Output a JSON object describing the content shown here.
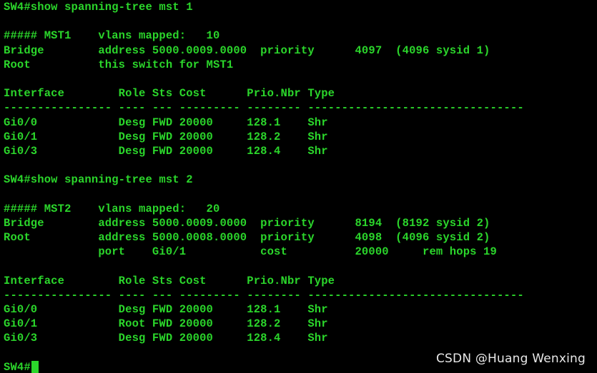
{
  "terminal": {
    "lines": [
      "SW4#show spanning-tree mst 1",
      "",
      "##### MST1    vlans mapped:   10",
      "Bridge        address 5000.0009.0000  priority      4097  (4096 sysid 1)",
      "Root          this switch for MST1",
      "",
      "Interface        Role Sts Cost      Prio.Nbr Type",
      "---------------- ---- --- --------- -------- --------------------------------",
      "Gi0/0            Desg FWD 20000     128.1    Shr",
      "Gi0/1            Desg FWD 20000     128.2    Shr",
      "Gi0/3            Desg FWD 20000     128.4    Shr",
      "",
      "SW4#show spanning-tree mst 2",
      "",
      "##### MST2    vlans mapped:   20",
      "Bridge        address 5000.0009.0000  priority      8194  (8192 sysid 2)",
      "Root          address 5000.0008.0000  priority      4098  (4096 sysid 2)",
      "              port    Gi0/1           cost          20000     rem hops 19",
      "",
      "Interface        Role Sts Cost      Prio.Nbr Type",
      "---------------- ---- --- --------- -------- --------------------------------",
      "Gi0/0            Desg FWD 20000     128.1    Shr",
      "Gi0/1            Root FWD 20000     128.2    Shr",
      "Gi0/3            Desg FWD 20000     128.4    Shr",
      ""
    ],
    "prompt": "SW4#",
    "foreground_color": "#2bd62b",
    "background_color": "#000000"
  },
  "watermark": {
    "text": "CSDN @Huang Wenxing"
  }
}
